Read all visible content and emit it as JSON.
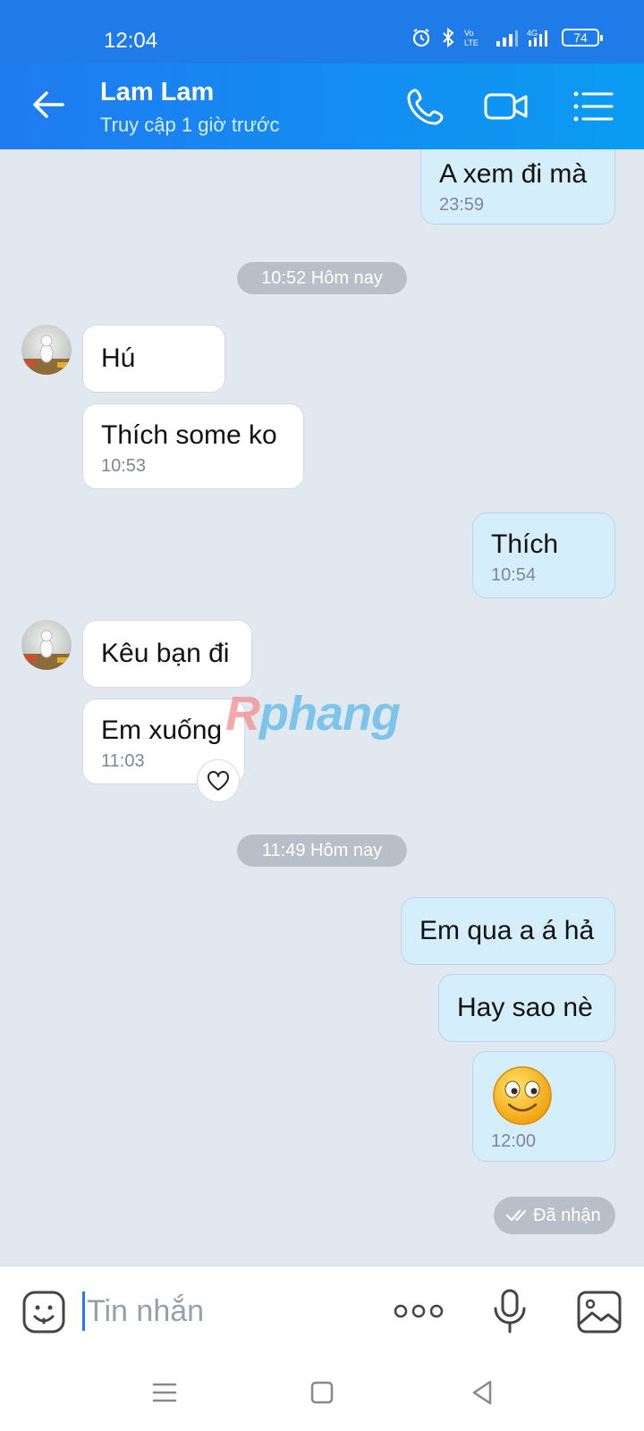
{
  "status_bar": {
    "time": "12:04",
    "battery": "74"
  },
  "header": {
    "contact_name": "Lam Lam",
    "last_seen": "Truy cập 1 giờ trước"
  },
  "messages": [
    {
      "text": "A xem đi mà",
      "time": "23:59"
    },
    {
      "separator": "10:52 Hôm nay"
    },
    {
      "text": "Hú"
    },
    {
      "text": "Thích some ko",
      "time": "10:53"
    },
    {
      "text": "Thích",
      "time": "10:54"
    },
    {
      "text": "Kêu bạn đi"
    },
    {
      "text": "Em xuống",
      "time": "11:03"
    },
    {
      "separator": "11:49 Hôm nay"
    },
    {
      "text": "Em qua a á hả"
    },
    {
      "text": "Hay sao nè"
    },
    {
      "time": "12:00"
    }
  ],
  "read_status": "Đã nhận",
  "watermark": {
    "part1": "R",
    "part2": "phang"
  },
  "input": {
    "placeholder": "Tin nhắn"
  },
  "colors": {
    "header_blue": "#1f7be8",
    "outgoing_bubble": "#d5eefc",
    "incoming_bubble": "#ffffff",
    "chat_background": "#e2e8ef"
  }
}
